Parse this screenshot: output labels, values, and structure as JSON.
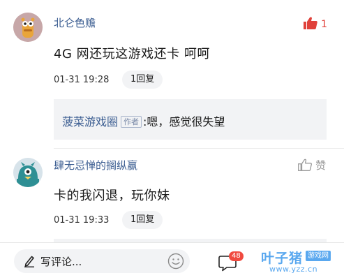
{
  "comments": [
    {
      "username": "北仑色赡",
      "text": "4G 网还玩这游戏还卡  呵呵",
      "time": "01-31 19:28",
      "reply_label": "1回复",
      "like_count": "1",
      "like_state": "liked",
      "avatar": "cartoon-bear-avatar",
      "reply": {
        "name": "菠菜游戏圈",
        "tag": "作者",
        "text": ":嗯，感觉很失望"
      }
    },
    {
      "username": "肆无忌惮的搁纵赢",
      "text": "卡的我闪退，玩你妹",
      "time": "01-31 19:33",
      "reply_label": "1回复",
      "like_label": "赞",
      "like_state": "not-liked",
      "avatar": "teal-monster-avatar"
    }
  ],
  "bottom_bar": {
    "write_placeholder": "写评论...",
    "comment_badge": "48",
    "icons": [
      "pencil-icon",
      "emoji-icon",
      "comment-bubble-icon"
    ]
  },
  "watermark": {
    "title": "叶子猪",
    "sub": "游戏网",
    "url": "www.yzz.cn"
  },
  "colors": {
    "username": "#3b5d91",
    "like_red": "#e0413a",
    "badge": "#f04a3f",
    "reply_bg": "#f2f3f5",
    "watermark_blue": "#5aa8ef"
  }
}
